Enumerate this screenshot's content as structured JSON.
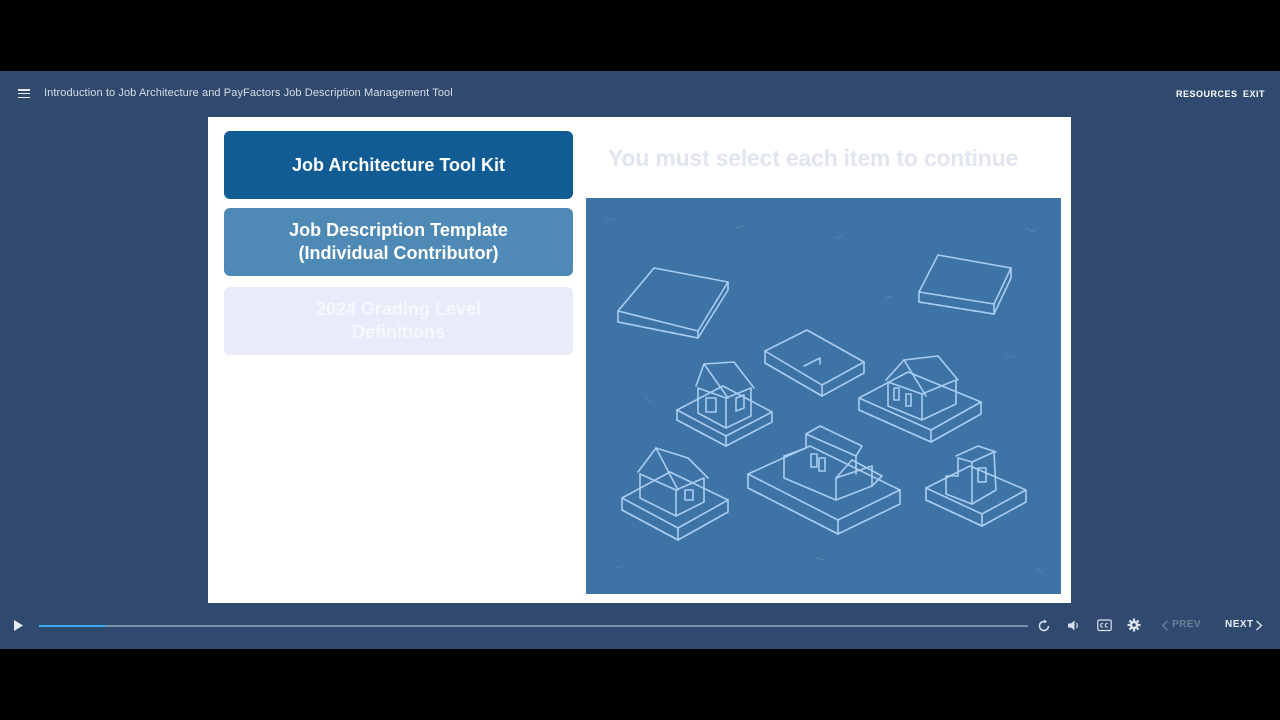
{
  "header": {
    "course_title": "Introduction to Job Architecture and PayFactors Job Description Management Tool",
    "resources_label": "RESOURCES",
    "exit_label": "EXIT"
  },
  "slide": {
    "instruction": "You must select each item to continue",
    "tabs": [
      {
        "label": "Job Architecture Tool Kit"
      },
      {
        "label": "Job Description Template\n(Individual Contributor)"
      },
      {
        "label": "2024 Grading Level\nDefinitions"
      }
    ]
  },
  "controls": {
    "progress": 0.068,
    "prev_label": "PREV",
    "next_label": "NEXT"
  },
  "colors": {
    "player_bg": "#2f4a6e",
    "tab_active": "#125c96",
    "tab_visited": "#4f89b5",
    "tab_disabled": "#e8ecfa",
    "illustration_bg": "#3e73a6",
    "progress_fill": "#3ea9f0"
  }
}
